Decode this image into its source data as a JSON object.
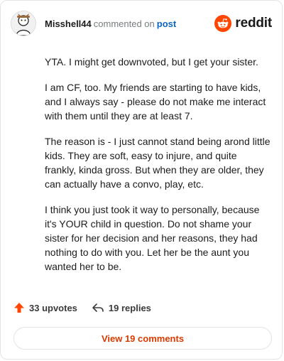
{
  "header": {
    "username": "Misshell44",
    "commented_text": "commented on",
    "post_link": "post",
    "brand_name": "reddit"
  },
  "comment": {
    "paragraphs": [
      "YTA. I might get downvoted, but I get your sister.",
      "I am CF, too. My friends are starting to have kids, and I always say - please do not make me interact with them until they are at least 7.",
      "The reason is - I just cannot stand being arond little kids. They are soft, easy to injure, and quite frankly, kinda gross. But when they are older, they can actually have a convo, play, etc.",
      "I think you just took it way to personally, because it's YOUR child in question. Do not shame your sister for her decision and her reasons, they had nothing to do with you. Let her be the aunt you wanted her to be."
    ]
  },
  "actions": {
    "upvotes_label": "33 upvotes",
    "replies_label": "19 replies",
    "view_comments_label": "View 19 comments"
  },
  "colors": {
    "brand_orange": "#ff4500",
    "link_blue": "#0a66c2",
    "view_button_text": "#d93a00"
  },
  "icons": {
    "avatar": "user-avatar",
    "brand": "reddit-snoo-icon",
    "upvote": "upvote-arrow-icon",
    "reply": "reply-arrow-icon"
  }
}
